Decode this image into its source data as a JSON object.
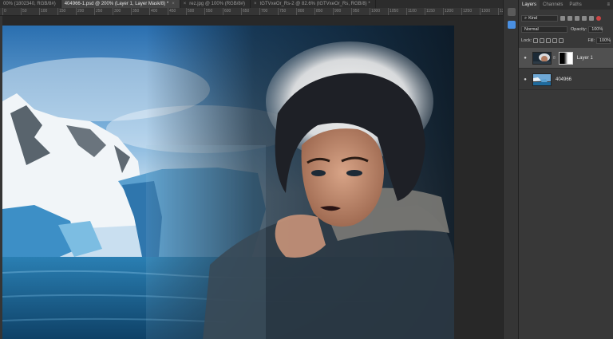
{
  "tabs": [
    {
      "label": "00% (1802340, RGB/8#)",
      "active": false
    },
    {
      "label": "404966-1.psd @ 200% (Layer 1, Layer Mask/8) *",
      "active": true
    },
    {
      "label": "rez.jpg @ 100% (RGB/8#)",
      "active": false
    },
    {
      "label": "tGTVxeOr_Rs-2 @ 82.6% (tGTVxeOr_Rs, RGB/8) *",
      "active": false
    }
  ],
  "tab_close_glyph": "×",
  "ruler": {
    "labels": [
      "0",
      "50",
      "100",
      "150",
      "200",
      "250",
      "300",
      "350",
      "400",
      "450",
      "500",
      "550",
      "600",
      "650",
      "700",
      "750",
      "800",
      "850",
      "900",
      "950",
      "1000",
      "1050",
      "1100",
      "1150",
      "1200",
      "1250",
      "1300",
      "1350"
    ]
  },
  "panel": {
    "tabs": [
      "Layers",
      "Channels",
      "Paths"
    ],
    "active_tab": "Layers",
    "menu_glyph": "≡",
    "filter": {
      "label": "Kind"
    },
    "blend_mode": "Normal",
    "opacity": {
      "label": "Opacity:",
      "value": "100%"
    },
    "lock": {
      "label": "Lock:"
    },
    "fill": {
      "label": "Fill:",
      "value": "100%"
    },
    "layers": [
      {
        "name": "Layer 1",
        "selected": true,
        "has_mask": true
      },
      {
        "name": "404966",
        "selected": false,
        "has_mask": false
      }
    ],
    "eye_glyph": "●",
    "chain_glyph": "8"
  },
  "colors": {
    "accent": "#4a90e2",
    "panel_bg": "#383838",
    "selected_layer": "#505050"
  }
}
